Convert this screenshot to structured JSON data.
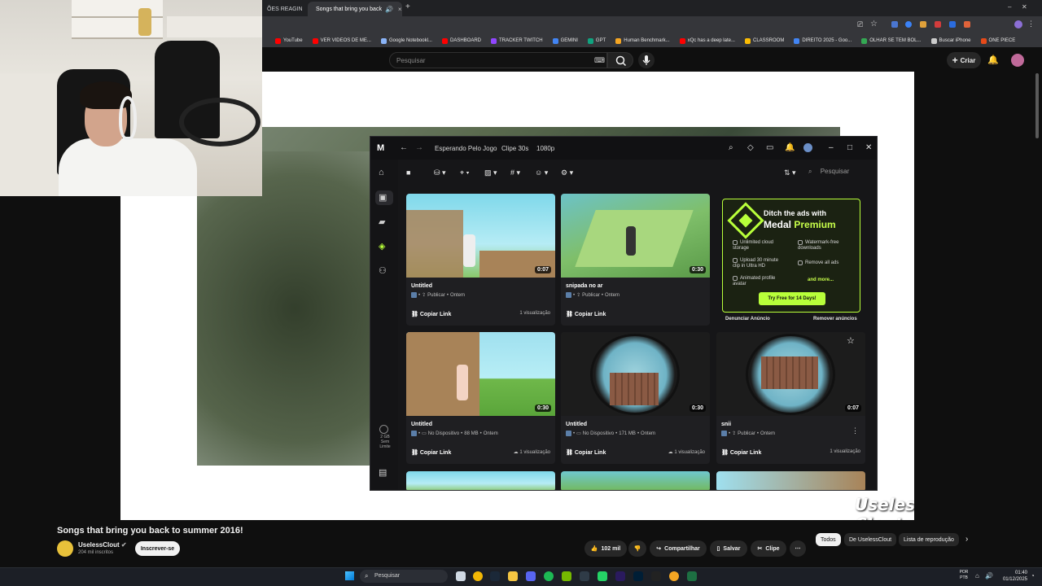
{
  "browser": {
    "tabs": [
      {
        "title": "ÕES REAGIN",
        "active": false
      },
      {
        "title": "Songs that bring you back",
        "active": true
      }
    ],
    "new_tab": "+",
    "tab_close": "×",
    "bookmarks": [
      {
        "label": "YouTube",
        "color": "#ff0000"
      },
      {
        "label": "VER VIDEOS DE ME...",
        "color": "#ff0000"
      },
      {
        "label": "Google Notebookl...",
        "color": "#8ab4f8"
      },
      {
        "label": "DASHBOARD",
        "color": "#ff0000"
      },
      {
        "label": "TRACKER TWITCH",
        "color": "#9146ff"
      },
      {
        "label": "GEMINI",
        "color": "#4285f4"
      },
      {
        "label": "GPT",
        "color": "#10a37f"
      },
      {
        "label": "Human Benchmark...",
        "color": "#f5a623"
      },
      {
        "label": "xQc has a deep late...",
        "color": "#ff0000"
      },
      {
        "label": "CLASSROOM",
        "color": "#fbbc04"
      },
      {
        "label": "DIREITO 2025 - Goo...",
        "color": "#4285f4"
      },
      {
        "label": "OLHAR SE TEM BOL...",
        "color": "#34a853"
      },
      {
        "label": "Buscar iPhone",
        "color": "#cccccc"
      },
      {
        "label": "ONE PIECE",
        "color": "#e64a19"
      }
    ]
  },
  "youtube": {
    "search_placeholder": "Pesquisar",
    "create_label": "Criar",
    "video_title": "Songs that bring you back to summer 2016!",
    "channel_name": "UselessClout",
    "subscribers": "204 mil inscritos",
    "subscribe_label": "Inscrever-se",
    "likes": "102 mil",
    "share_label": "Compartilhar",
    "save_label": "Salvar",
    "clip_label": "Clipe",
    "chips": [
      "Todos",
      "De UselessClout",
      "Lista de reprodução"
    ],
    "watermark": "Useless Clout"
  },
  "medal": {
    "breadcrumbs": [
      "Esperando Pelo Jogo",
      "Clipe 30s",
      "1080p"
    ],
    "search_placeholder": "Pesquisar",
    "storage": [
      "2 GB",
      "Sem",
      "Limite"
    ],
    "clips": [
      {
        "title": "Untitled",
        "meta": [
          "Publicar",
          "Ontem"
        ],
        "duration": "0:07",
        "copy": "Copiar Link",
        "views": "1 visualização"
      },
      {
        "title": "snipada no ar",
        "meta": [
          "Publicar",
          "Ontem"
        ],
        "duration": "0:30",
        "copy": "Copiar Link",
        "views": ""
      },
      {
        "title": "Untitled",
        "meta": [
          "No Dispositivo",
          "88 MB",
          "Ontem"
        ],
        "duration": "0:30",
        "copy": "Copiar Link",
        "views": "1 visualização"
      },
      {
        "title": "Untitled",
        "meta": [
          "No Dispositivo",
          "171 MB",
          "Ontem"
        ],
        "duration": "0:30",
        "copy": "Copiar Link",
        "views": "1 visualização"
      },
      {
        "title": "snii",
        "meta": [
          "Publicar",
          "Ontem"
        ],
        "duration": "0:07",
        "copy": "Copiar Link",
        "views": "1 visualização"
      }
    ],
    "ad": {
      "line1": "Ditch the ads with",
      "line2a": "Medal ",
      "line2b": "Premium",
      "features": [
        "Unlimited cloud storage",
        "Watermark-free downloads",
        "Upload 30 minute clip in Ultra HD",
        "Remove all ads",
        "Animated profile avatar",
        "and more..."
      ],
      "cta": "Try Free for 14 Days!",
      "report": "Denunciar Anúncio",
      "remove": "Remover anúncios"
    }
  },
  "taskbar": {
    "search": "Pesquisar",
    "lang": [
      "POR",
      "PTB"
    ],
    "time": "01:40",
    "date": "01/12/2025"
  },
  "colors": {
    "medal_accent": "#b8ff3a",
    "youtube_red": "#ff0000"
  }
}
